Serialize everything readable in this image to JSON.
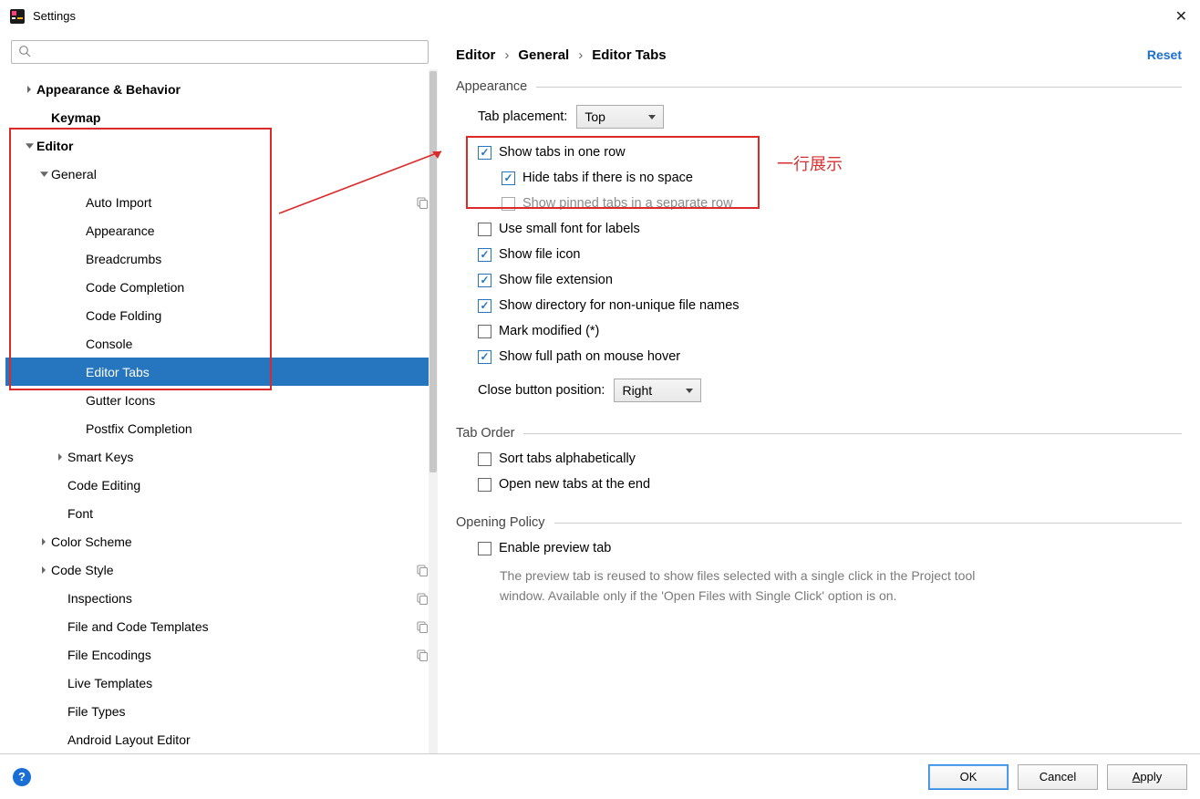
{
  "window": {
    "title": "Settings"
  },
  "sidebar": {
    "search_placeholder": "",
    "tree": [
      {
        "label": "Appearance & Behavior",
        "level": 0,
        "bold": true,
        "expander": "right"
      },
      {
        "label": "Keymap",
        "level": 1,
        "bold": true
      },
      {
        "label": "Editor",
        "level": 0,
        "bold": true,
        "expander": "down"
      },
      {
        "label": "General",
        "level": 1,
        "expander": "down"
      },
      {
        "label": "Auto Import",
        "level": 3,
        "copy": true
      },
      {
        "label": "Appearance",
        "level": 3
      },
      {
        "label": "Breadcrumbs",
        "level": 3
      },
      {
        "label": "Code Completion",
        "level": 3
      },
      {
        "label": "Code Folding",
        "level": 3
      },
      {
        "label": "Console",
        "level": 3
      },
      {
        "label": "Editor Tabs",
        "level": 3,
        "selected": true
      },
      {
        "label": "Gutter Icons",
        "level": 3
      },
      {
        "label": "Postfix Completion",
        "level": 3
      },
      {
        "label": "Smart Keys",
        "level": 2,
        "expander": "right"
      },
      {
        "label": "Code Editing",
        "level": 2
      },
      {
        "label": "Font",
        "level": 2
      },
      {
        "label": "Color Scheme",
        "level": 1,
        "expander": "right"
      },
      {
        "label": "Code Style",
        "level": 1,
        "expander": "right",
        "copy": true
      },
      {
        "label": "Inspections",
        "level": 2,
        "copy": true
      },
      {
        "label": "File and Code Templates",
        "level": 2,
        "copy": true
      },
      {
        "label": "File Encodings",
        "level": 2,
        "copy": true
      },
      {
        "label": "Live Templates",
        "level": 2
      },
      {
        "label": "File Types",
        "level": 2
      },
      {
        "label": "Android Layout Editor",
        "level": 2
      }
    ]
  },
  "content": {
    "breadcrumb": [
      "Editor",
      "General",
      "Editor Tabs"
    ],
    "reset": "Reset",
    "sections": {
      "appearance": {
        "title": "Appearance",
        "tab_placement_label": "Tab placement:",
        "tab_placement_value": "Top",
        "show_tabs_one_row": "Show tabs in one row",
        "hide_tabs_no_space": "Hide tabs if there is no space",
        "show_pinned_separate": "Show pinned tabs in a separate row",
        "use_small_font": "Use small font for labels",
        "show_file_icon": "Show file icon",
        "show_file_ext": "Show file extension",
        "show_dir_nonunique": "Show directory for non-unique file names",
        "mark_modified": "Mark modified (*)",
        "show_full_path_hover": "Show full path on mouse hover",
        "close_button_label": "Close button position:",
        "close_button_value": "Right"
      },
      "tab_order": {
        "title": "Tab Order",
        "sort_alpha": "Sort tabs alphabetically",
        "open_new_end": "Open new tabs at the end"
      },
      "opening_policy": {
        "title": "Opening Policy",
        "enable_preview": "Enable preview tab",
        "desc": "The preview tab is reused to show files selected with a single click in the Project tool window. Available only if the 'Open Files with Single Click' option is on."
      }
    }
  },
  "annotation": {
    "text": "一行展示"
  },
  "footer": {
    "ok": "OK",
    "cancel": "Cancel",
    "apply": "Apply"
  }
}
